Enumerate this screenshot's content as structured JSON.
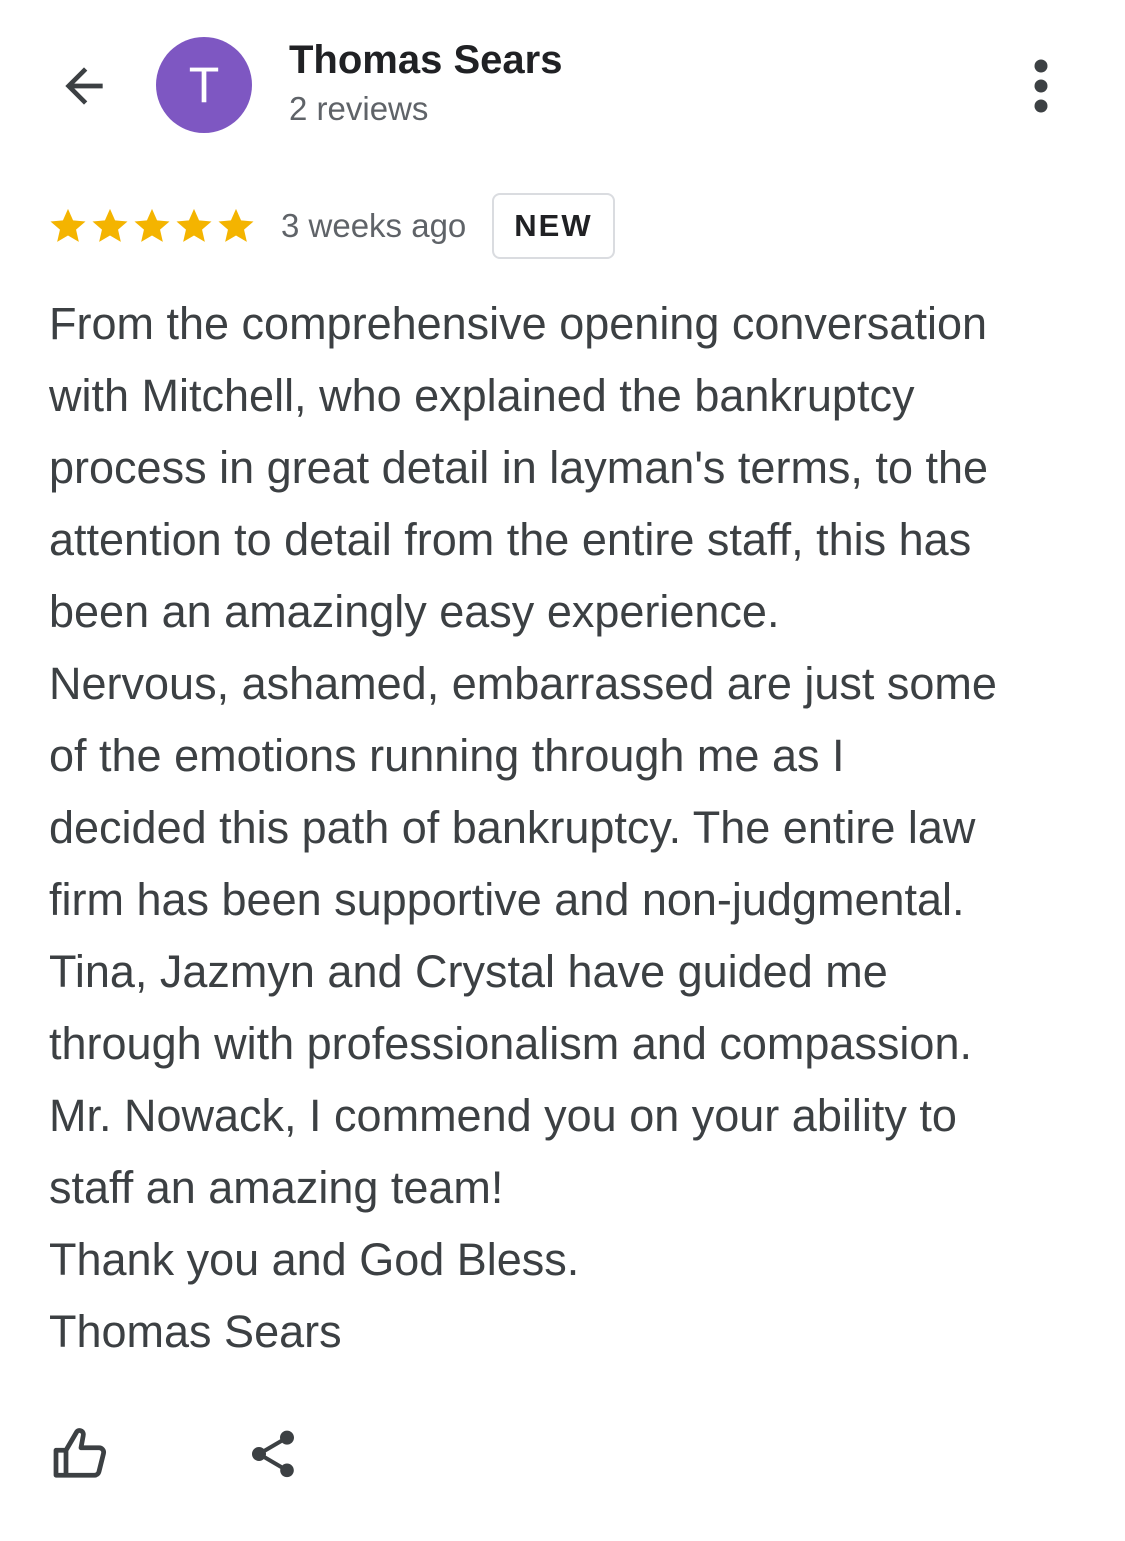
{
  "header": {
    "back_icon": "arrow-back-icon",
    "avatar_letter": "T",
    "avatar_color": "#7e57c2",
    "author_name": "Thomas Sears",
    "review_count": "2 reviews",
    "more_icon": "more-vert-icon"
  },
  "review": {
    "rating": 5,
    "rating_max": 5,
    "star_color": "#f4b400",
    "time_ago": "3 weeks ago",
    "badge": "NEW",
    "lines": [
      "From the comprehensive opening conversation",
      "with Mitchell, who explained the bankruptcy",
      "process in great detail in layman's terms, to the",
      "attention to detail from the entire staff, this has",
      "been an amazingly easy experience.",
      "Nervous, ashamed, embarrassed are just some",
      "of the emotions running through me as I",
      "decided this path of bankruptcy. The entire law",
      "firm has been supportive and non-judgmental.",
      "Tina, Jazmyn and Crystal have guided me",
      "through with professionalism and compassion.",
      "Mr. Nowack, I commend you on your ability to",
      "staff an amazing team!",
      "Thank you and God Bless.",
      "Thomas Sears"
    ]
  },
  "actions": {
    "like_icon": "thumbs-up-icon",
    "share_icon": "share-icon"
  }
}
